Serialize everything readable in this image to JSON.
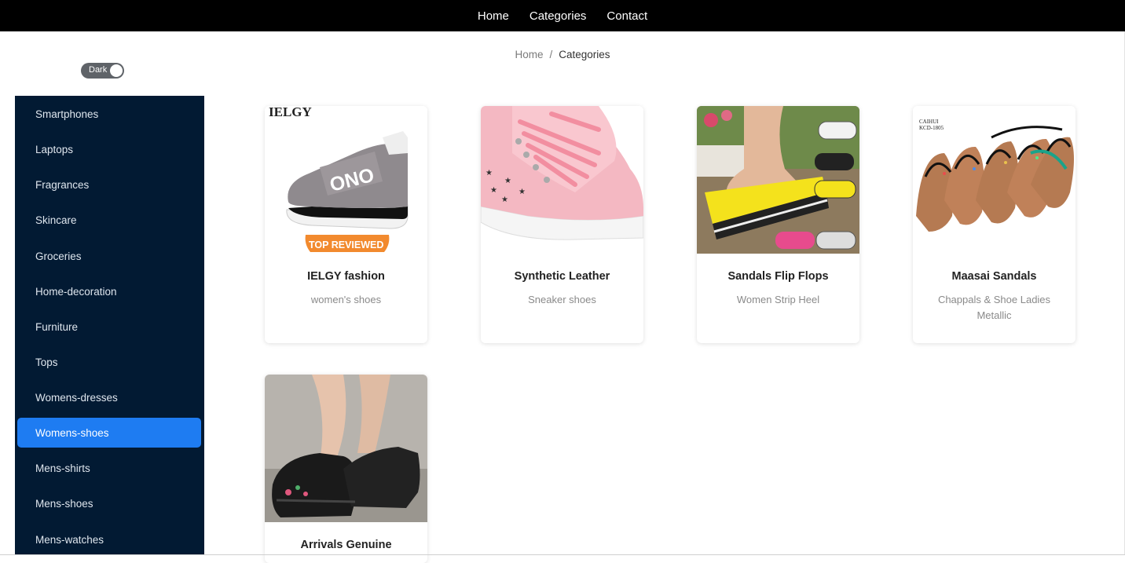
{
  "nav": {
    "links": [
      "Home",
      "Categories",
      "Contact"
    ]
  },
  "breadcrumb": {
    "home": "Home",
    "separator": "/",
    "current": "Categories"
  },
  "theme_toggle": {
    "label": "Dark",
    "checked": true
  },
  "sidebar": {
    "items": [
      {
        "label": "Smartphones",
        "active": false
      },
      {
        "label": "Laptops",
        "active": false
      },
      {
        "label": "Fragrances",
        "active": false
      },
      {
        "label": "Skincare",
        "active": false
      },
      {
        "label": "Groceries",
        "active": false
      },
      {
        "label": "Home-decoration",
        "active": false
      },
      {
        "label": "Furniture",
        "active": false
      },
      {
        "label": "Tops",
        "active": false
      },
      {
        "label": "Womens-dresses",
        "active": false
      },
      {
        "label": "Womens-shoes",
        "active": true
      },
      {
        "label": "Mens-shirts",
        "active": false
      },
      {
        "label": "Mens-shoes",
        "active": false
      },
      {
        "label": "Mens-watches",
        "active": false
      }
    ]
  },
  "products": [
    {
      "title": "IELGY fashion",
      "description": "women's shoes",
      "image_text": "IELGY",
      "badge": "TOP REVIEWED",
      "shoe_text": "ONO"
    },
    {
      "title": "Synthetic Leather",
      "description": "Sneaker shoes"
    },
    {
      "title": "Sandals Flip Flops",
      "description": "Women Strip Heel"
    },
    {
      "title": "Maasai Sandals",
      "description": "Chappals & Shoe Ladies Metallic",
      "image_text_1": "CAIHUI",
      "image_text_2": "KCD-1805"
    },
    {
      "title": "Arrivals Genuine",
      "description": ""
    }
  ],
  "colors": {
    "topbar": "#000000",
    "sidebar": "#021a33",
    "active_item": "#1e7cf2"
  }
}
